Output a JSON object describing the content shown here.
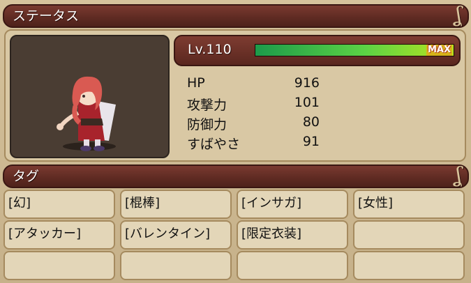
{
  "status_header": {
    "title": "ステータス"
  },
  "level": {
    "label": "Lv.110",
    "gauge_fraction": 1.0,
    "gauge_badge": "MAX"
  },
  "stats": [
    {
      "name": "HP",
      "value": "916"
    },
    {
      "name": "攻撃力",
      "value": "101"
    },
    {
      "name": "防御力",
      "value": "80"
    },
    {
      "name": "すばやさ",
      "value": "91"
    }
  ],
  "tag_header": {
    "title": "タグ"
  },
  "tags": [
    "[幻]",
    "[棍棒]",
    "[インサガ]",
    "[女性]",
    "[アタッカー]",
    "[バレンタイン]",
    "[限定衣装]",
    "",
    "",
    "",
    "",
    ""
  ],
  "colors": {
    "header_bg": "#5e2a22",
    "panel_bg": "#d9c8a4",
    "gauge_start": "#1c9a4a",
    "gauge_end": "#b8e41f",
    "badge": "#d7b21a"
  }
}
